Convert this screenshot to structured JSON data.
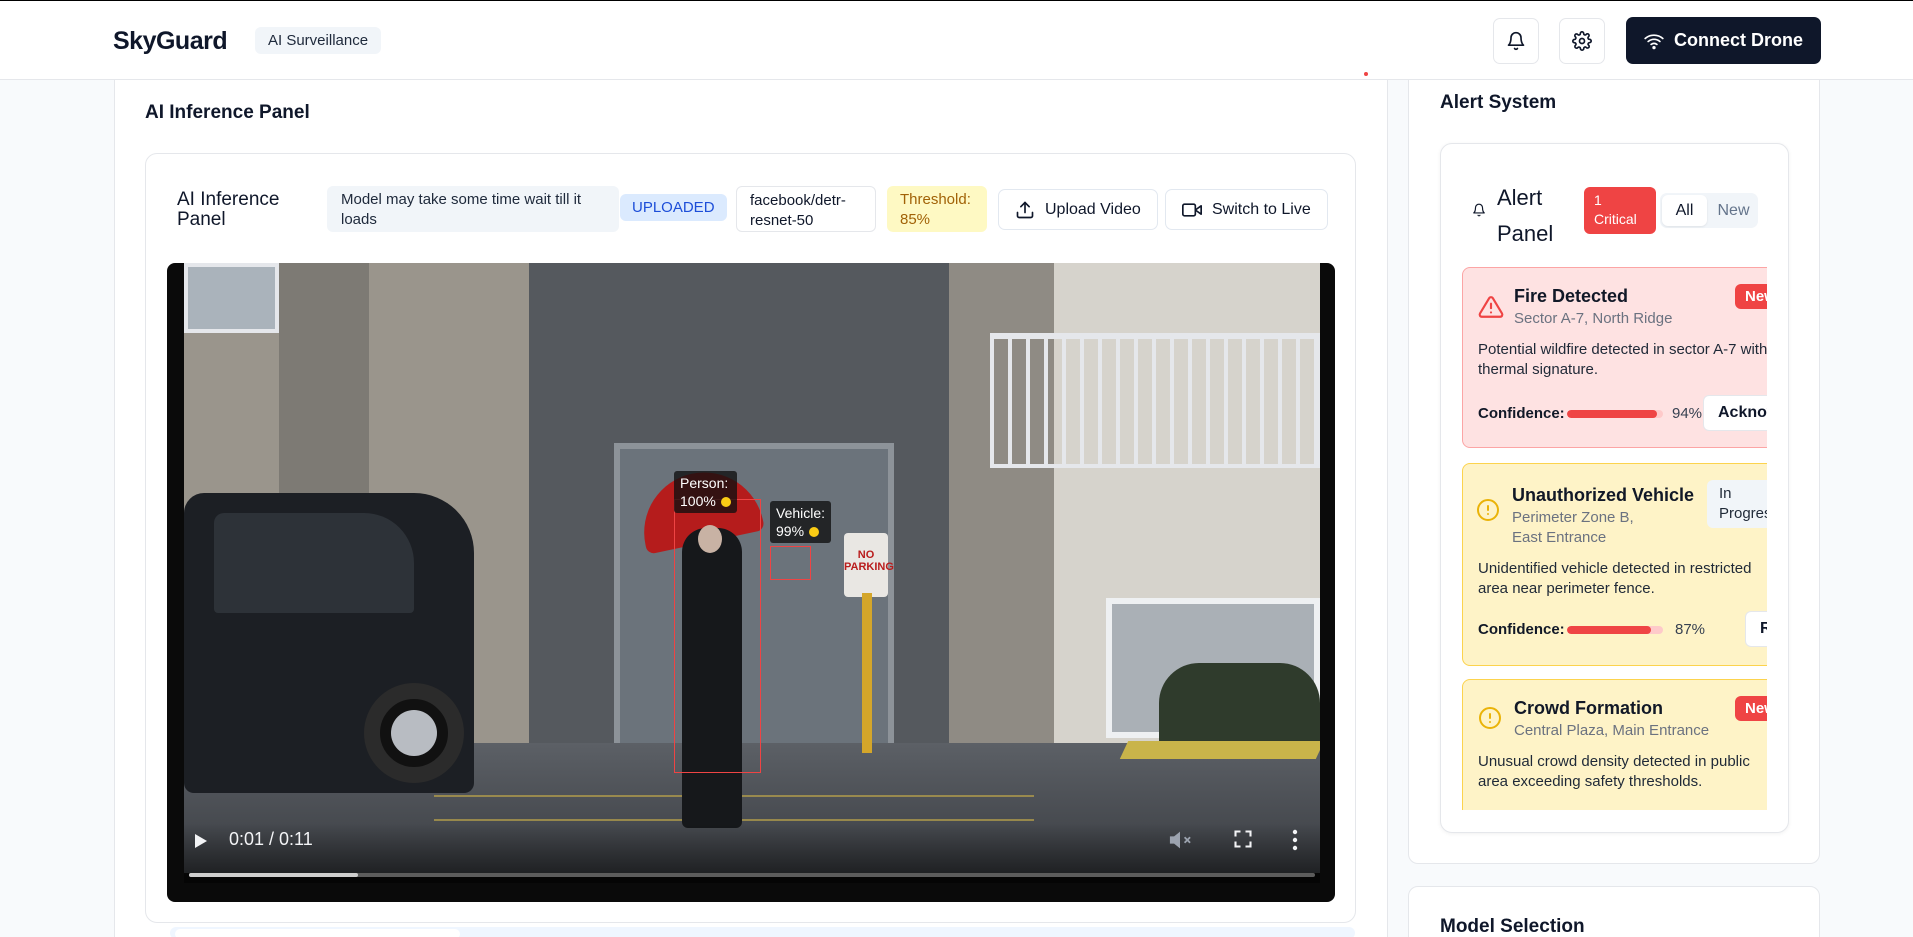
{
  "header": {
    "brand": "SkyGuard",
    "tag": "AI Surveillance",
    "connect_label": "Connect Drone",
    "icons": [
      "bell-icon",
      "gear-icon",
      "wifi-icon"
    ]
  },
  "inference": {
    "section_title": "AI Inference Panel",
    "panel_title": "AI Inference Panel",
    "notice": "Model may take some time wait till it loads",
    "status_badge": "UPLOADED",
    "model_name": "facebook/detr-resnet-50",
    "threshold": "Threshold: 85%",
    "upload_label": "Upload Video",
    "switch_label": "Switch to Live"
  },
  "video": {
    "time": "0:01 / 0:11",
    "progress": 0.15,
    "detections": [
      {
        "label": "Person:",
        "score": "100%"
      },
      {
        "label": "Vehicle:",
        "score": "99%"
      }
    ],
    "sign_text": "NO PARKING"
  },
  "alerts": {
    "section_title": "Alert System",
    "panel_title": "Alert Panel",
    "critical_badge": "1 Critical",
    "filter_all": "All",
    "filter_new": "New",
    "items": [
      {
        "title": "Fire Detected",
        "location": "Sector A-7, North Ridge",
        "status": "New",
        "description": "Potential wildfire detected in sector A-7 with thermal signature.",
        "confidence_label": "Confidence:",
        "confidence": "94%",
        "action": "Acknowledge"
      },
      {
        "title": "Unauthorized Vehicle",
        "location": "Perimeter Zone B, East Entrance",
        "status": "In Progress",
        "description": "Unidentified vehicle detected in restricted area near perimeter fence.",
        "confidence_label": "Confidence:",
        "confidence": "87%",
        "action": "Resolve"
      },
      {
        "title": "Crowd Formation",
        "location": "Central Plaza, Main Entrance",
        "status": "New",
        "description": "Unusual crowd density detected in public area exceeding safety thresholds."
      }
    ]
  },
  "model_selection": {
    "title": "Model Selection"
  },
  "colors": {
    "primary": "#0f172a",
    "critical": "#ef4444",
    "warning": "#f59e0b",
    "uploaded": "#1d4ed8"
  }
}
